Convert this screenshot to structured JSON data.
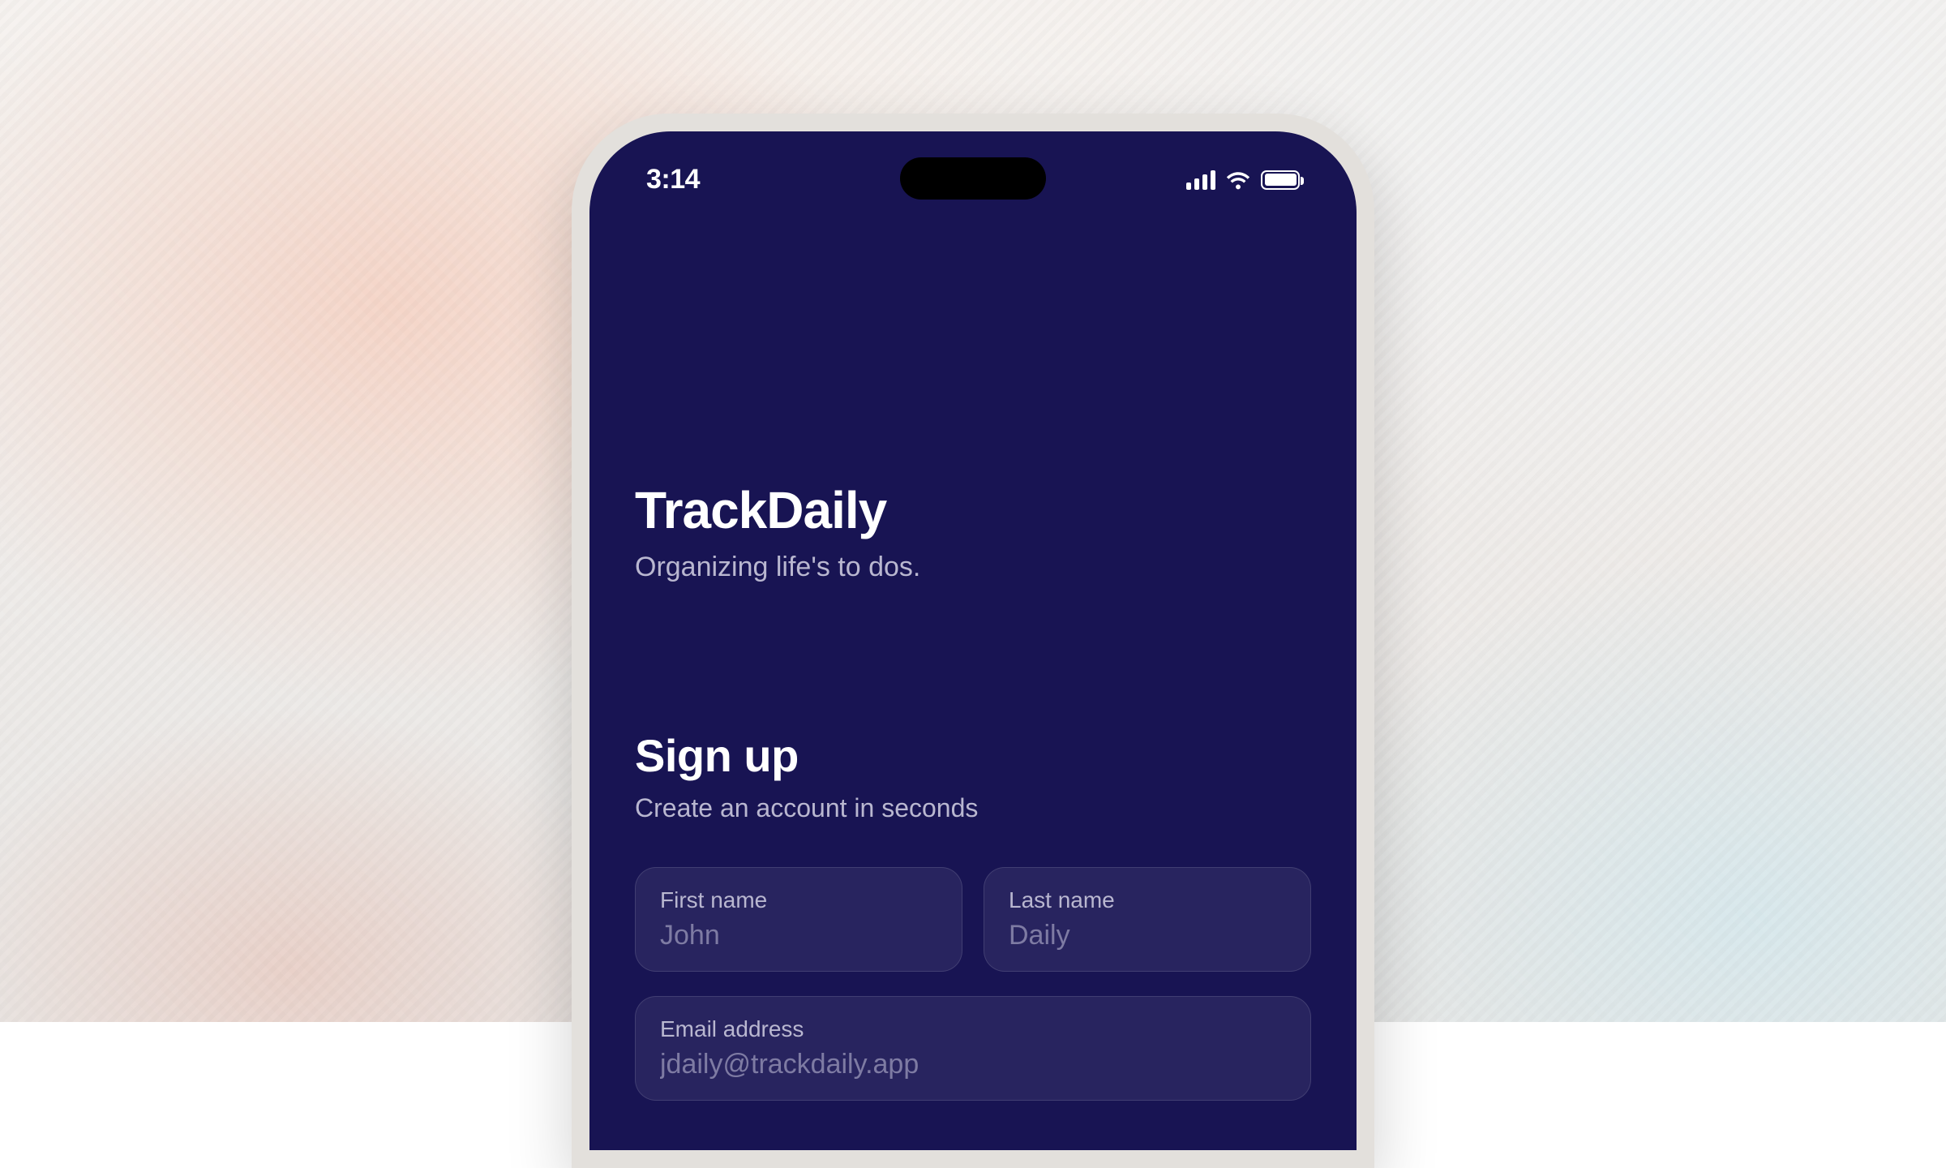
{
  "statusBar": {
    "time": "3:14"
  },
  "app": {
    "title": "TrackDaily",
    "tagline": "Organizing life's to dos."
  },
  "signup": {
    "heading": "Sign up",
    "subheading": "Create an account in seconds",
    "fields": {
      "firstName": {
        "label": "First name",
        "placeholder": "John"
      },
      "lastName": {
        "label": "Last name",
        "placeholder": "Daily"
      },
      "email": {
        "label": "Email address",
        "placeholder": "jdaily@trackdaily.app"
      }
    }
  }
}
